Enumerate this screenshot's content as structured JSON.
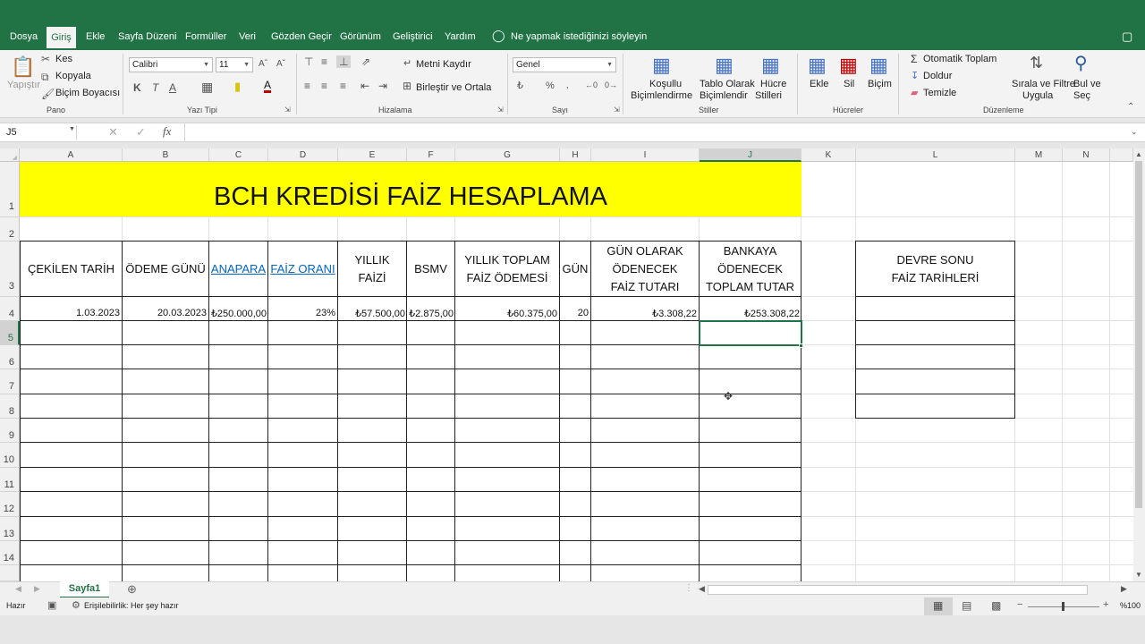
{
  "menu": {
    "tabs": [
      "Dosya",
      "Giriş",
      "Ekle",
      "Sayfa Düzeni",
      "Formüller",
      "Veri",
      "Gözden Geçir",
      "Görünüm",
      "Geliştirici",
      "Yardım"
    ],
    "tell_me": "Ne yapmak istediğinizi söyleyin"
  },
  "ribbon": {
    "paste": "Yapıştır",
    "cut": "Kes",
    "copy": "Kopyala",
    "format_painter": "Biçim Boyacısı",
    "group_clipboard": "Pano",
    "font_name": "Calibri",
    "font_size": "11",
    "group_font": "Yazı Tipi",
    "wrap_text": "Metni Kaydır",
    "merge_center": "Birleştir ve Ortala",
    "group_alignment": "Hizalama",
    "number_format": "Genel",
    "group_number": "Sayı",
    "cond_format_1": "Koşullu",
    "cond_format_2": "Biçimlendirme",
    "format_table_1": "Tablo Olarak",
    "format_table_2": "Biçimlendir",
    "cell_styles_1": "Hücre",
    "cell_styles_2": "Stilleri",
    "group_styles": "Stiller",
    "insert": "Ekle",
    "delete": "Sil",
    "format": "Biçim",
    "group_cells": "Hücreler",
    "autosum": "Otomatik Toplam",
    "fill": "Doldur",
    "clear": "Temizle",
    "sort_filter_1": "Sırala ve Filtre",
    "sort_filter_2": "Uygula",
    "find_select_1": "Bul ve",
    "find_select_2": "Seç",
    "group_editing": "Düzenleme"
  },
  "formula_bar": {
    "name_box": "J5",
    "fx": "fx",
    "value": ""
  },
  "columns": [
    "A",
    "B",
    "C",
    "D",
    "E",
    "F",
    "G",
    "H",
    "I",
    "J",
    "K",
    "L",
    "M",
    "N"
  ],
  "rows": [
    "1",
    "2",
    "3",
    "4",
    "5",
    "6",
    "7",
    "8",
    "9",
    "10",
    "11",
    "12",
    "13",
    "14"
  ],
  "sheet": {
    "title": "BCH KREDİSİ FAİZ HESAPLAMA",
    "headers": {
      "a": "ÇEKİLEN TARİH",
      "b": "ÖDEME GÜNÜ",
      "c": "ANAPARA",
      "d": "FAİZ ORANI",
      "e": "YILLIK FAİZİ",
      "f": "BSMV",
      "g": "YILLIK TOPLAM FAİZ ÖDEMESİ",
      "h": "GÜN",
      "i": "GÜN OLARAK ÖDENECEK FAİZ TUTARI",
      "j": "BANKAYA ÖDENECEK TOPLAM TUTAR",
      "l": "DEVRE SONU FAİZ TARİHLERİ"
    },
    "row4": {
      "a": "1.03.2023",
      "b": "20.03.2023",
      "c": "₺250.000,00",
      "d": "23%",
      "e": "₺57.500,00",
      "f": "₺2.875,00",
      "g": "₺60.375,00",
      "h": "20",
      "i": "₺3.308,22",
      "j": "₺253.308,22"
    }
  },
  "sheet_tabs": {
    "active": "Sayfa1"
  },
  "status": {
    "ready": "Hazır",
    "accessibility": "Erişilebilirlik: Her şey hazır",
    "zoom": "%100"
  },
  "colors": {
    "brand": "#217346",
    "title_fill": "#ffff00",
    "link": "#0563c1"
  }
}
